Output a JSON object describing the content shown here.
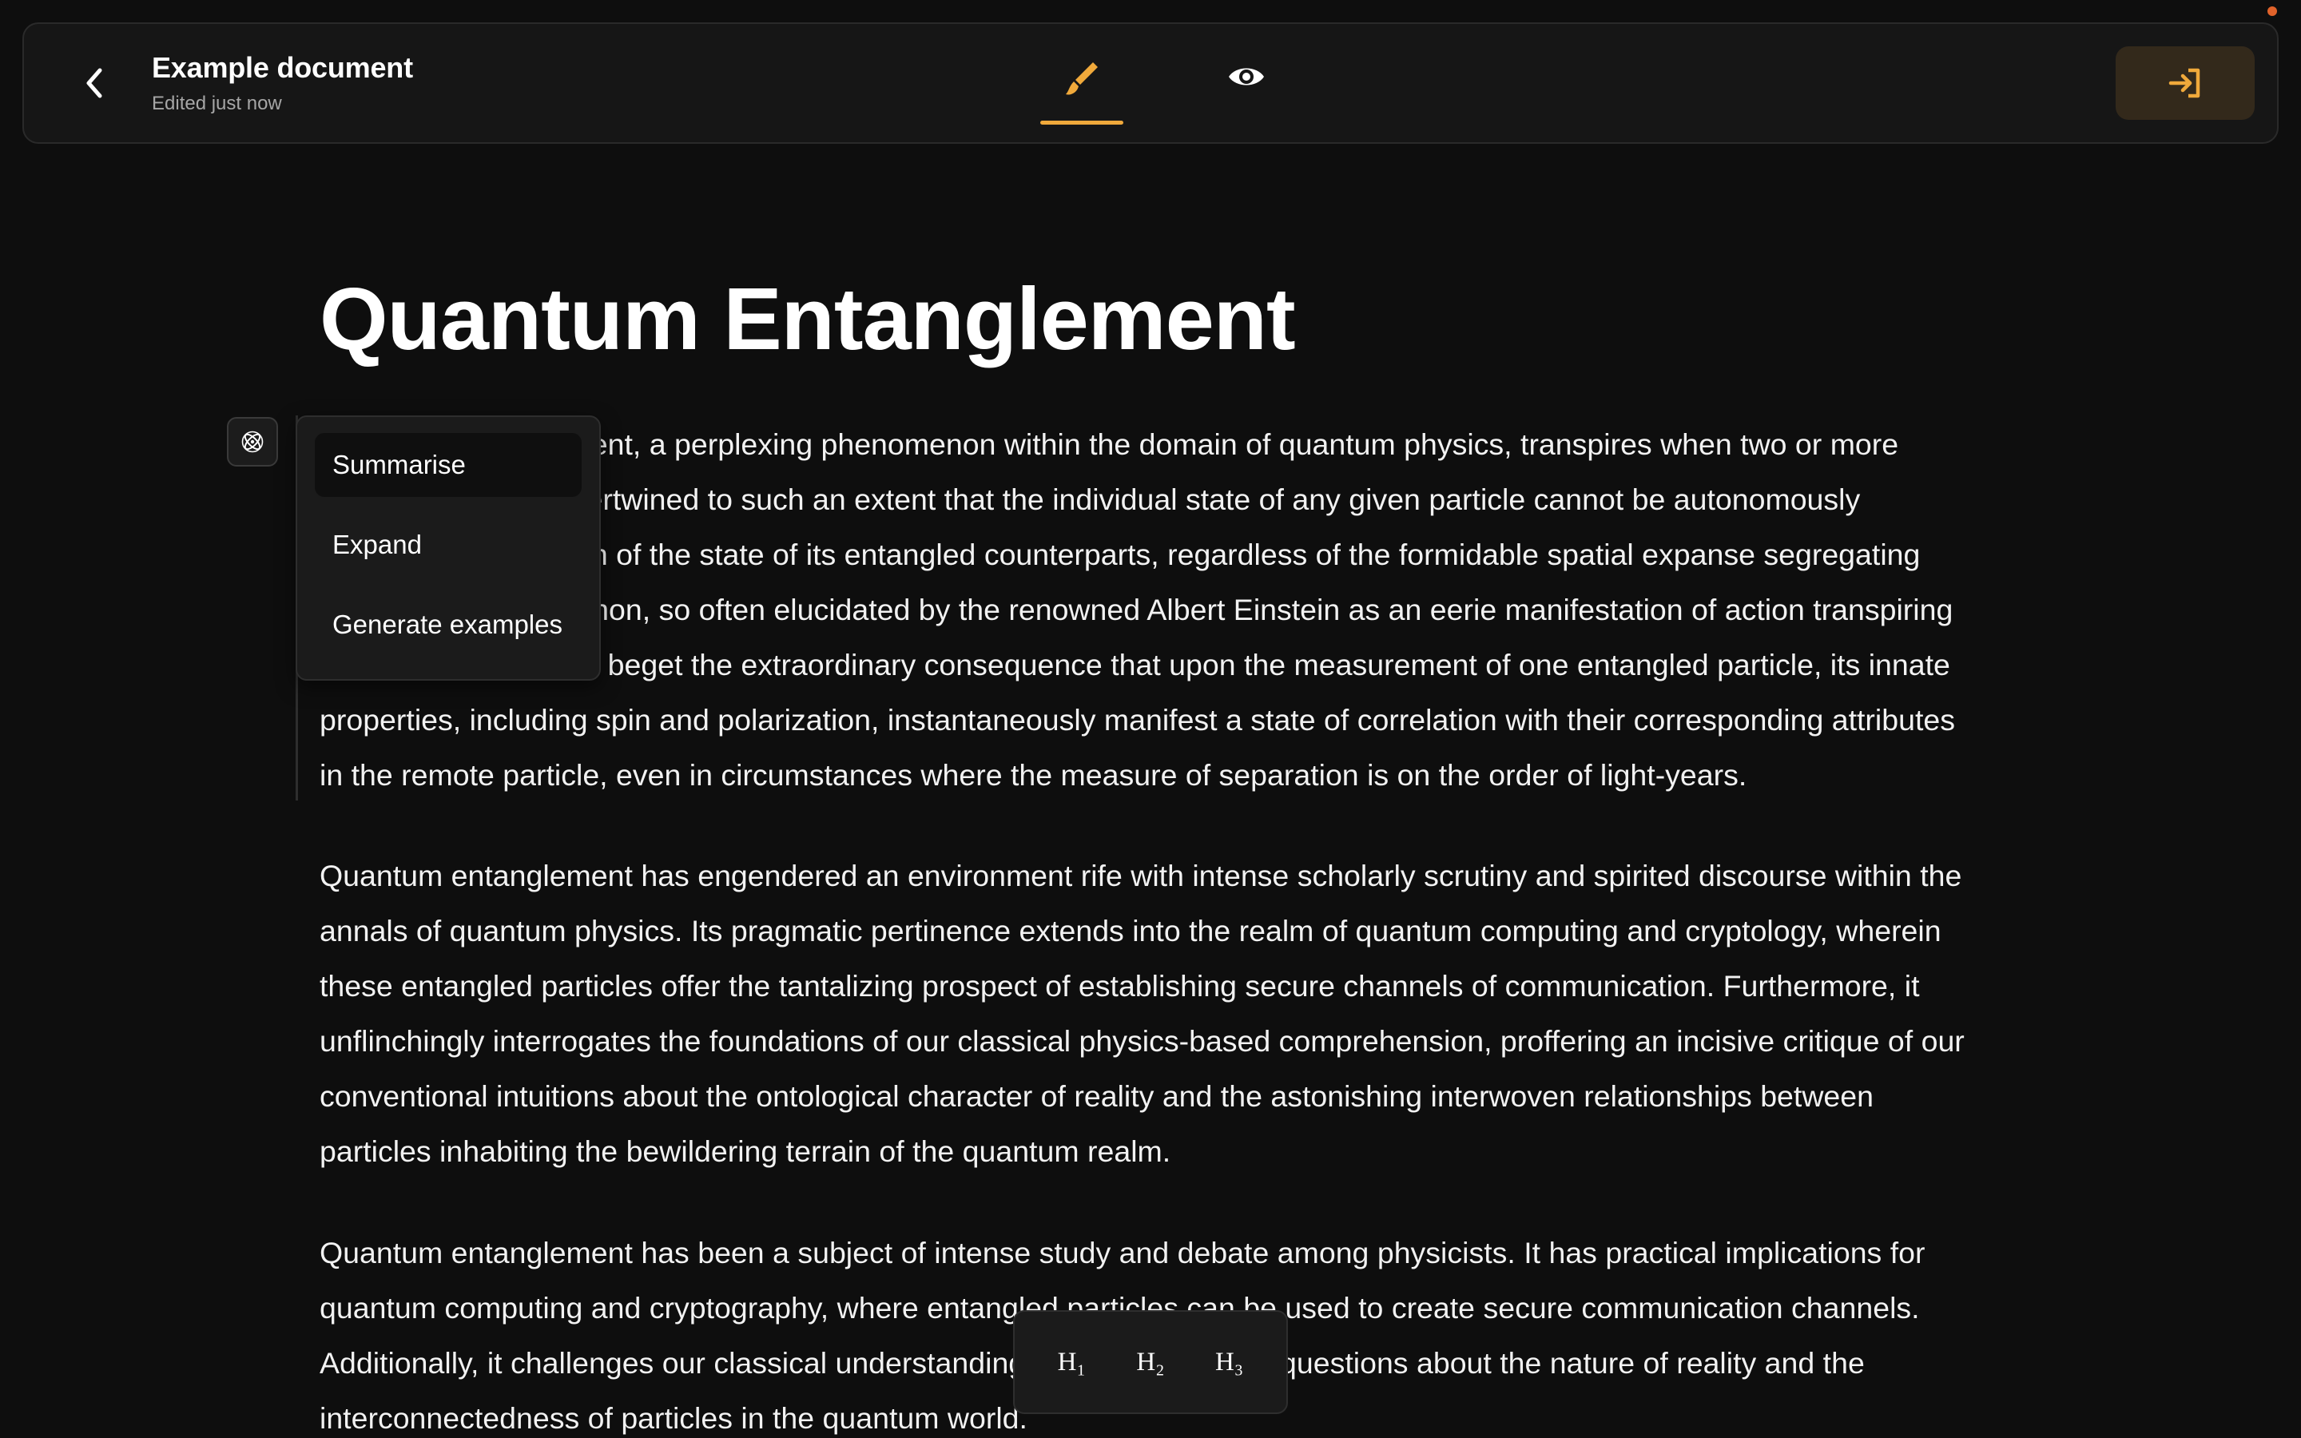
{
  "header": {
    "back_icon": "chevron-left-icon",
    "document_title": "Example document",
    "document_status": "Edited just now",
    "modes": [
      {
        "name": "edit",
        "icon": "brush-icon",
        "active": true
      },
      {
        "name": "preview",
        "icon": "eye-icon",
        "active": false
      }
    ],
    "exit_icon": "sign-in-arrow-icon",
    "accent_color": "#f0a93b"
  },
  "document": {
    "heading": "Quantum Entanglement",
    "paragraphs": [
      "Quantum entanglement, a perplexing phenomenon within the domain of quantum physics, transpires when two or more particles become intertwined to such an extent that the individual state of any given particle cannot be autonomously delineated in isolation of the state of its entangled counterparts, regardless of the formidable spatial expanse segregating them. This phenomenon, so often elucidated by the renowned Albert Einstein as an eerie manifestation of action transpiring at a remote distance, beget the extraordinary consequence that upon the measurement of one entangled particle, its innate properties, including spin and polarization, instantaneously manifest a state of correlation with their corresponding attributes in the remote particle, even in circumstances where the measure of separation is on the order of light-years.",
      "Quantum entanglement has engendered an environment rife with intense scholarly scrutiny and spirited discourse within the annals of quantum physics. Its pragmatic pertinence extends into the realm of quantum computing and cryptology, wherein these entangled particles offer the tantalizing prospect of establishing secure channels of communication. Furthermore, it unflinchingly interrogates the foundations of our classical physics-based comprehension, proffering an incisive critique of our conventional intuitions about the ontological character of reality and the astonishing interwoven relationships between particles inhabiting the bewildering terrain of the quantum realm.",
      "Quantum entanglement has been a subject of intense study and debate among physicists. It has practical implications for quantum computing and cryptography, where entangled particles can be used to create secure communication channels. Additionally, it challenges our classical understanding of physics, raising questions about the nature of reality and the interconnectedness of particles in the quantum world."
    ]
  },
  "ai_menu": {
    "trigger_icon": "atom-icon",
    "items": [
      "Summarise",
      "Expand",
      "Generate examples"
    ],
    "active_index": 0
  },
  "heading_toolbar": {
    "buttons": [
      "H₁",
      "H₂",
      "H₃"
    ]
  }
}
